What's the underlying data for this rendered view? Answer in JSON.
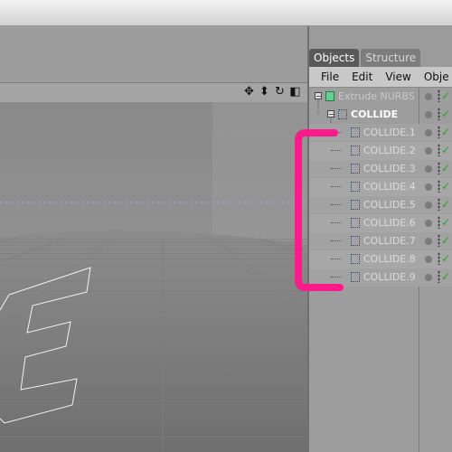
{
  "viewport": {
    "nav_icons": [
      {
        "name": "move-icon",
        "glyph": "✥"
      },
      {
        "name": "dolly-icon",
        "glyph": "⬍"
      },
      {
        "name": "rotate-icon",
        "glyph": "↻"
      },
      {
        "name": "maximize-icon",
        "glyph": "◧"
      }
    ],
    "annotation_color": "#ff1a8c"
  },
  "objects_panel": {
    "tabs": [
      {
        "label": "Objects",
        "active": true
      },
      {
        "label": "Structure",
        "active": false
      }
    ],
    "menu": [
      "File",
      "Edit",
      "View",
      "Obje"
    ],
    "tree": [
      {
        "label": "Extrude NURBS",
        "level": 0,
        "icon": "extrude-nurbs-icon",
        "expander": "−"
      },
      {
        "label": "COLLIDE",
        "level": 1,
        "icon": "spline-icon",
        "expander": "−"
      },
      {
        "label": "COLLIDE.1",
        "level": 2,
        "icon": "spline-icon"
      },
      {
        "label": "COLLIDE.2",
        "level": 2,
        "icon": "spline-icon"
      },
      {
        "label": "COLLIDE.3",
        "level": 2,
        "icon": "spline-icon"
      },
      {
        "label": "COLLIDE.4",
        "level": 2,
        "icon": "spline-icon"
      },
      {
        "label": "COLLIDE.5",
        "level": 2,
        "icon": "spline-icon"
      },
      {
        "label": "COLLIDE.6",
        "level": 2,
        "icon": "spline-icon"
      },
      {
        "label": "COLLIDE.7",
        "level": 2,
        "icon": "spline-icon"
      },
      {
        "label": "COLLIDE.8",
        "level": 2,
        "icon": "spline-icon"
      },
      {
        "label": "COLLIDE.9",
        "level": 2,
        "icon": "spline-icon"
      }
    ]
  }
}
